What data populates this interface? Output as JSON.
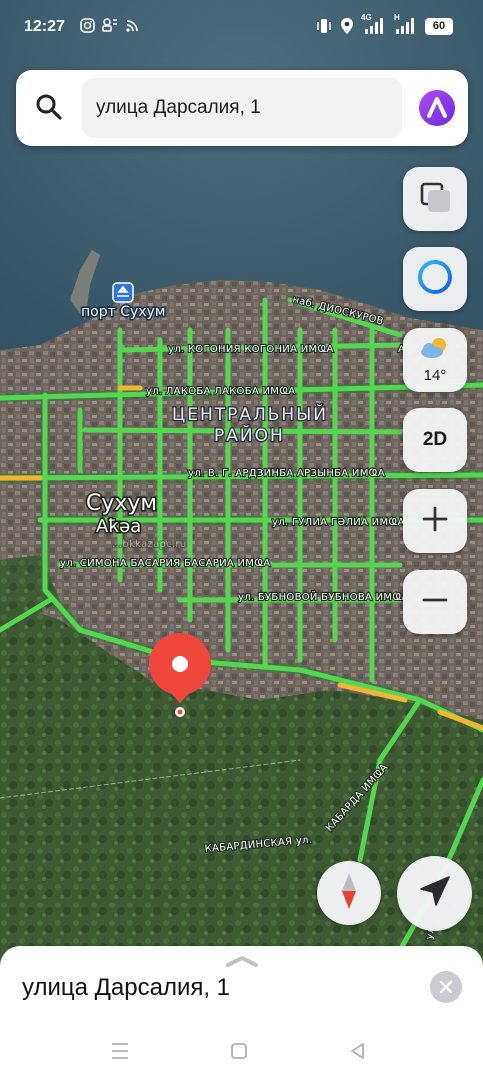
{
  "status_bar": {
    "time": "12:27",
    "left_icons": [
      "instagram-icon",
      "notification-icon",
      "wifi-sync-icon"
    ],
    "right_icons": [
      "vibrate-icon",
      "location-icon",
      "signal-4g-icon",
      "signal-icon"
    ],
    "network_label_1": "4G",
    "network_label_2": "H",
    "battery": "60"
  },
  "search": {
    "query": "улица Дарсалия, 1",
    "icon": "search-icon",
    "assistant_icon": "alice-icon"
  },
  "map": {
    "city": "Сухум",
    "city_alt": "Аҟәа",
    "district_line1": "ЦЕНТРАЛЬНЫЙ",
    "district_line2": "РАЙОН",
    "port": "порт Сухум",
    "streets": {
      "kogonia": "ул. КОГОНИЯ   КОГОНИА ИМҨА",
      "lakoba": "ул. ЛАКОБА   ЛАКОБА ИМҨА",
      "ardzinba": "ул. В. Г. АРДЗИНБА   АРЗЫНБА ИМҨА",
      "gulia": "ул. ГУЛИА   ГӘЛИА ИМҨА",
      "basaria": "ул. СИМОНА БАСАРИЯ   БАСАРИА ИМҨА",
      "bubnovoi": "ул. БУБНОВОЙ   БУБНОВА ИМҨА",
      "dioskurov": "наб. ДИОСКУРОВ",
      "kabardinskaya": "КАБАРДИНСКАЯ ул.",
      "kabardaimfa": "КАБАРДА ИМҨА",
      "partial_right": "А",
      "partial_bottom": "ул."
    },
    "watermark": "...bkkazapc.ru",
    "traffic_color_free": "#4cd44c",
    "traffic_color_slow": "#f2b632",
    "pin_color": "#f0463c"
  },
  "controls": {
    "layers_icon": "layers-icon",
    "alice_assistant_icon": "alice-ring-icon",
    "weather_icon": "partly-cloudy-icon",
    "weather_temp": "14°",
    "mode_label": "2D",
    "zoom_in_icon": "plus-icon",
    "zoom_out_icon": "minus-icon",
    "compass_icon": "compass-icon",
    "locate_icon": "navigation-arrow-icon"
  },
  "bottom_sheet": {
    "title": "улица Дарсалия, 1",
    "close_icon": "close-icon",
    "handle_icon": "chevron-up-icon"
  },
  "nav_bar": {
    "menu_icon": "recents-icon",
    "home_icon": "home-icon",
    "back_icon": "back-icon"
  }
}
